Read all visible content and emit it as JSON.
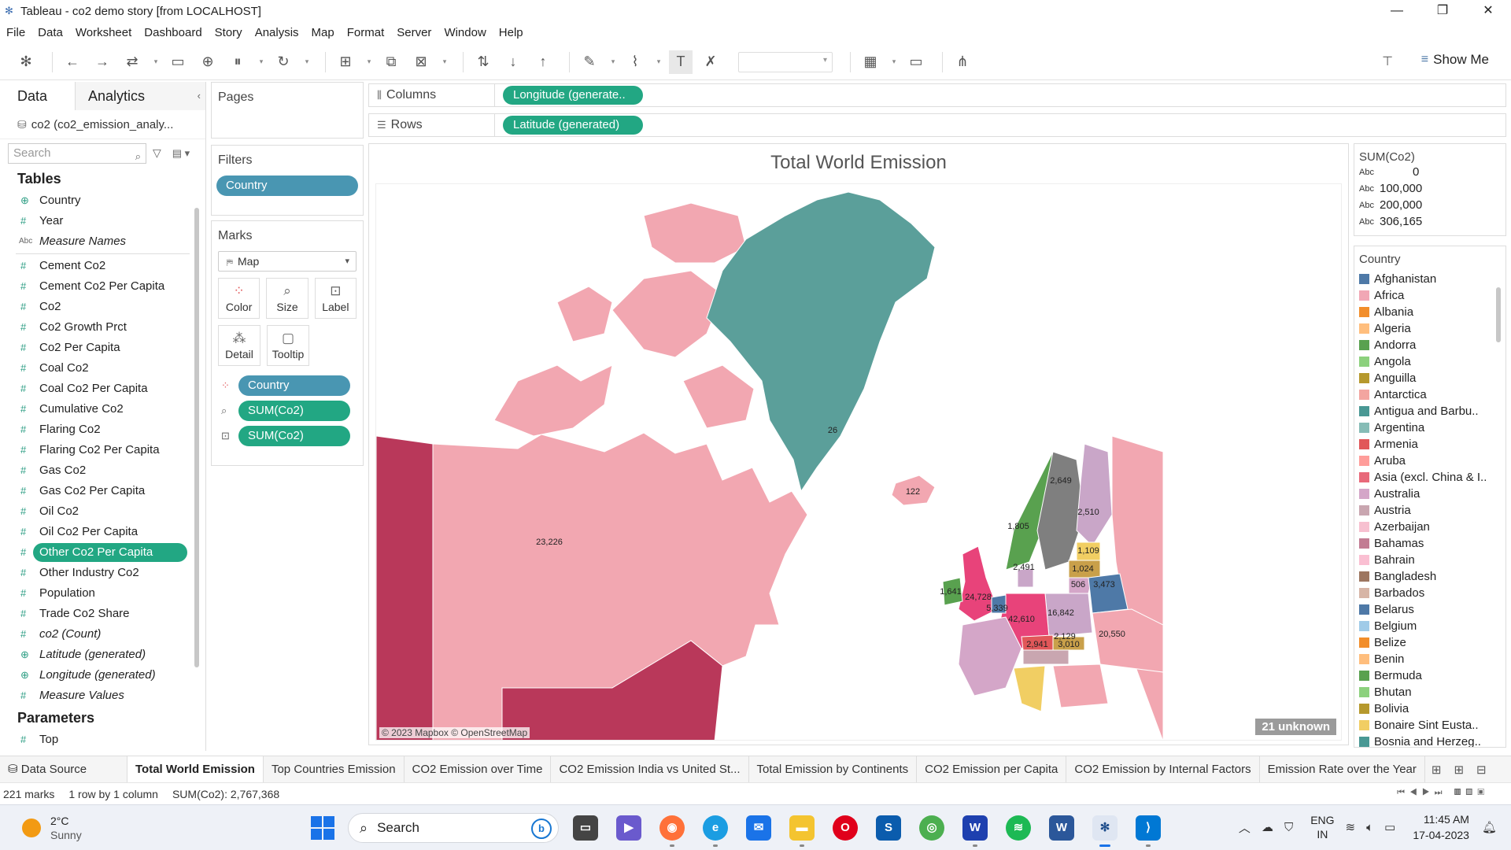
{
  "window": {
    "title": "Tableau - co2 demo story [from LOCALHOST]",
    "controls": [
      "—",
      "❐",
      "✕"
    ]
  },
  "menu": [
    "File",
    "Data",
    "Worksheet",
    "Dashboard",
    "Story",
    "Analysis",
    "Map",
    "Format",
    "Server",
    "Window",
    "Help"
  ],
  "toolbar": {
    "show_me": "Show Me"
  },
  "data_pane": {
    "tab_data": "Data",
    "tab_analytics": "Analytics",
    "datasource": "co2 (co2_emission_analy...",
    "search_placeholder": "Search",
    "tables_heading": "Tables",
    "fields": [
      {
        "label": "Country",
        "kind": "geo"
      },
      {
        "label": "Year",
        "kind": "num"
      },
      {
        "label": "Measure Names",
        "kind": "abc"
      },
      {
        "label": "Cement Co2",
        "kind": "num"
      },
      {
        "label": "Cement Co2 Per Capita",
        "kind": "num"
      },
      {
        "label": "Co2",
        "kind": "num"
      },
      {
        "label": "Co2 Growth Prct",
        "kind": "num"
      },
      {
        "label": "Co2 Per Capita",
        "kind": "num"
      },
      {
        "label": "Coal Co2",
        "kind": "num"
      },
      {
        "label": "Coal Co2 Per Capita",
        "kind": "num"
      },
      {
        "label": "Cumulative Co2",
        "kind": "num"
      },
      {
        "label": "Flaring Co2",
        "kind": "num"
      },
      {
        "label": "Flaring Co2 Per Capita",
        "kind": "num"
      },
      {
        "label": "Gas Co2",
        "kind": "num"
      },
      {
        "label": "Gas Co2 Per Capita",
        "kind": "num"
      },
      {
        "label": "Oil Co2",
        "kind": "num"
      },
      {
        "label": "Oil Co2 Per Capita",
        "kind": "num"
      },
      {
        "label": "Other Co2 Per Capita",
        "kind": "num"
      },
      {
        "label": "Other Industry Co2",
        "kind": "num"
      },
      {
        "label": "Population",
        "kind": "num"
      },
      {
        "label": "Trade Co2 Share",
        "kind": "num"
      },
      {
        "label": "co2 (Count)",
        "kind": "num"
      },
      {
        "label": "Latitude (generated)",
        "kind": "geo"
      },
      {
        "label": "Longitude (generated)",
        "kind": "geo"
      },
      {
        "label": "Measure Values",
        "kind": "num"
      }
    ],
    "parameters_heading": "Parameters",
    "parameters": [
      {
        "label": "Top",
        "kind": "num"
      }
    ]
  },
  "shelves": {
    "pages": "Pages",
    "filters": "Filters",
    "filter_pill": "Country",
    "marks": "Marks",
    "mark_type": "Map",
    "mark_buttons": [
      "Color",
      "Size",
      "Label",
      "Detail",
      "Tooltip"
    ],
    "mark_pills": [
      "Country",
      "SUM(Co2)",
      "SUM(Co2)"
    ],
    "columns_label": "Columns",
    "columns_pill": "Longitude (generate..",
    "rows_label": "Rows",
    "rows_pill": "Latitude (generated)"
  },
  "viz": {
    "title": "Total World Emission",
    "copyright": "© 2023 Mapbox © OpenStreetMap",
    "unknown_badge": "21 unknown",
    "map_labels": [
      {
        "text": "23,226",
        "region": "canada"
      },
      {
        "text": "26",
        "region": "greenland"
      },
      {
        "text": "122",
        "region": "iceland"
      },
      {
        "text": "2,649",
        "region": "sweden"
      },
      {
        "text": "2,510",
        "region": "finland"
      },
      {
        "text": "1,805",
        "region": "norway"
      },
      {
        "text": "1,109",
        "region": "estonia"
      },
      {
        "text": "1,024",
        "region": "latvia"
      },
      {
        "text": "506",
        "region": "lithuania"
      },
      {
        "text": "3,473",
        "region": "belarus"
      },
      {
        "text": "16,842",
        "region": "poland"
      },
      {
        "text": "42,610",
        "region": "germany"
      },
      {
        "text": "24,728",
        "region": "uk"
      },
      {
        "text": "1,641",
        "region": "ireland"
      },
      {
        "text": "5,339",
        "region": "netherlands"
      },
      {
        "text": "2,491",
        "region": "denmark"
      },
      {
        "text": "20,550",
        "region": "ukraine"
      },
      {
        "text": "2,941",
        "region": "czechia"
      },
      {
        "text": "3,010",
        "region": "slovakia"
      },
      {
        "text": "2,129",
        "region": "austria"
      }
    ]
  },
  "size_legend": {
    "title": "SUM(Co2)",
    "items": [
      "0",
      "100,000",
      "200,000",
      "306,165"
    ]
  },
  "color_legend": {
    "title": "Country",
    "items": [
      {
        "label": "Afghanistan",
        "color": "#4e79a7"
      },
      {
        "label": "Africa",
        "color": "#f1a7b5"
      },
      {
        "label": "Albania",
        "color": "#f28e2b"
      },
      {
        "label": "Algeria",
        "color": "#ffbe7d"
      },
      {
        "label": "Andorra",
        "color": "#59a14f"
      },
      {
        "label": "Angola",
        "color": "#8cd17d"
      },
      {
        "label": "Anguilla",
        "color": "#b6992d"
      },
      {
        "label": "Antarctica",
        "color": "#f3a5a0"
      },
      {
        "label": "Antigua and Barbu..",
        "color": "#499894"
      },
      {
        "label": "Argentina",
        "color": "#86bcb6"
      },
      {
        "label": "Armenia",
        "color": "#e15759"
      },
      {
        "label": "Aruba",
        "color": "#ff9d9a"
      },
      {
        "label": "Asia (excl. China & I..",
        "color": "#e8697a"
      },
      {
        "label": "Australia",
        "color": "#d4a6c8"
      },
      {
        "label": "Austria",
        "color": "#c9a6b0"
      },
      {
        "label": "Azerbaijan",
        "color": "#f7c0d0"
      },
      {
        "label": "Bahamas",
        "color": "#c27c93"
      },
      {
        "label": "Bahrain",
        "color": "#fabfd2"
      },
      {
        "label": "Bangladesh",
        "color": "#9d7660"
      },
      {
        "label": "Barbados",
        "color": "#d7b5a6"
      },
      {
        "label": "Belarus",
        "color": "#4e79a7"
      },
      {
        "label": "Belgium",
        "color": "#a0cbe8"
      },
      {
        "label": "Belize",
        "color": "#f28e2b"
      },
      {
        "label": "Benin",
        "color": "#ffbe7d"
      },
      {
        "label": "Bermuda",
        "color": "#59a14f"
      },
      {
        "label": "Bhutan",
        "color": "#8cd17d"
      },
      {
        "label": "Bolivia",
        "color": "#b6992d"
      },
      {
        "label": "Bonaire Sint Eusta..",
        "color": "#f1ce63"
      },
      {
        "label": "Bosnia and Herzeg..",
        "color": "#499894"
      }
    ]
  },
  "sheet_tabs": {
    "data_source": "Data Source",
    "tabs": [
      "Total World Emission",
      "Top Countries Emission",
      "CO2 Emission over Time",
      "CO2 Emission India vs United St...",
      "Total Emission by Continents",
      "CO2 Emission per Capita",
      "CO2 Emission by Internal Factors",
      "Emission Rate over the Year"
    ],
    "active_index": 0
  },
  "status": {
    "marks": "221 marks",
    "dims": "1 row by 1 column",
    "sum": "SUM(Co2): 2,767,368"
  },
  "taskbar": {
    "temp": "2°C",
    "weather": "Sunny",
    "search": "Search",
    "lang1": "ENG",
    "lang2": "IN",
    "time": "11:45 AM",
    "date": "17-04-2023"
  },
  "colors": {
    "pill_green": "#22a783",
    "pill_blue": "#4996b2",
    "canada": "#f2a7b1",
    "greenland": "#5b9f9a",
    "alaska": "#b9385a",
    "usa": "#b9385a"
  }
}
